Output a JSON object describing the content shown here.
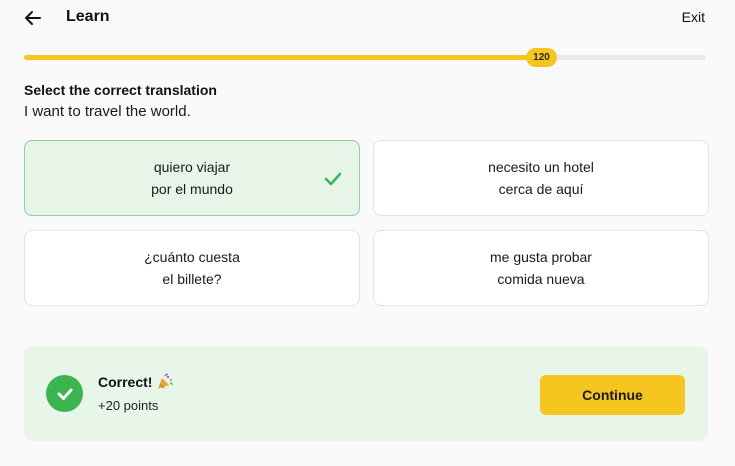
{
  "header": {
    "title": "Learn",
    "exit_label": "Exit",
    "back_icon": "arrow-left-icon"
  },
  "progress": {
    "fraction": 0.758,
    "badge_value": "120",
    "color": "#f7c51f"
  },
  "prompt": {
    "label": "Select the correct translation",
    "sentence": "I want to travel the world."
  },
  "options": [
    {
      "text": "quiero viajar\npor el mundo",
      "selected": true,
      "correct": true
    },
    {
      "text": "necesito un hotel\ncerca de aquí",
      "selected": false,
      "correct": false
    },
    {
      "text": "¿cuánto cuesta\nel billete?",
      "selected": false,
      "correct": false
    },
    {
      "text": "me gusta probar\ncomida nueva",
      "selected": false,
      "correct": false
    }
  ],
  "feedback": {
    "title": "Correct!",
    "points": "+20 points",
    "icon": "check-circle-icon",
    "title_icon": "party-popper-icon",
    "continue_label": "Continue"
  },
  "colors": {
    "accent": "#f7c51f",
    "success": "#3cb550",
    "success_bg": "#e8f5e9",
    "selected_border": "#8fd19a"
  }
}
